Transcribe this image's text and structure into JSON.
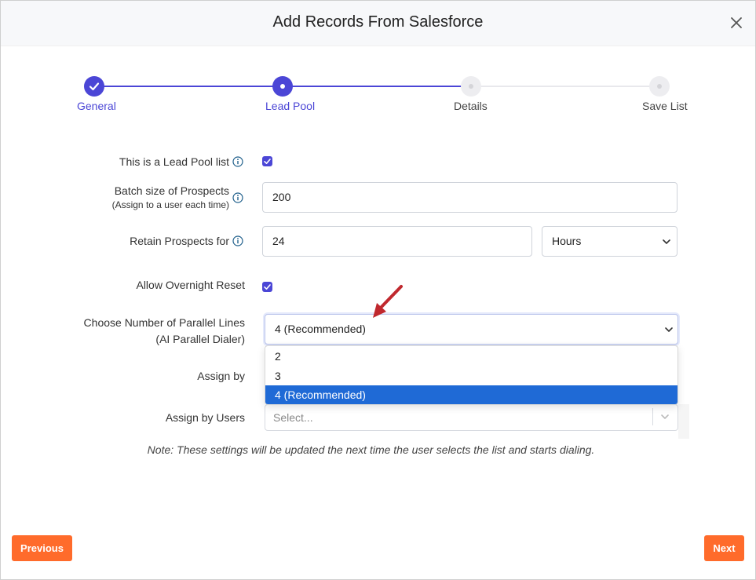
{
  "modal": {
    "title": "Add Records From Salesforce"
  },
  "steps": [
    {
      "label": "General",
      "state": "done"
    },
    {
      "label": "Lead Pool",
      "state": "active"
    },
    {
      "label": "Details",
      "state": "todo"
    },
    {
      "label": "Save List",
      "state": "todo"
    }
  ],
  "form": {
    "lead_pool": {
      "label": "This is a Lead Pool list",
      "checked": true
    },
    "batch": {
      "label": "Batch size of Prospects",
      "sublabel": "(Assign to a user each time)",
      "value": "200"
    },
    "retain": {
      "label": "Retain Prospects for",
      "value": "24",
      "unit": "Hours"
    },
    "overnight": {
      "label": "Allow Overnight Reset",
      "checked": true
    },
    "parallel": {
      "label_line1": "Choose Number of Parallel Lines",
      "label_line2": "(AI Parallel Dialer)",
      "value": "4 (Recommended)",
      "options": [
        "2",
        "3",
        "4 (Recommended)"
      ]
    },
    "assign_by": {
      "label": "Assign by"
    },
    "assign_users": {
      "label": "Assign by Users",
      "placeholder": "Select..."
    }
  },
  "note": "Note: These settings will be updated the next time the user selects the list and starts dialing.",
  "buttons": {
    "previous": "Previous",
    "next": "Next"
  },
  "colors": {
    "accent": "#4b46d6",
    "action": "#ff6b2b",
    "highlight": "#1f6ad6",
    "annotation_arrow": "#c0282e"
  },
  "icons": [
    "close-icon",
    "check-icon",
    "info-icon",
    "chevron-down-icon",
    "annotation-arrow"
  ]
}
